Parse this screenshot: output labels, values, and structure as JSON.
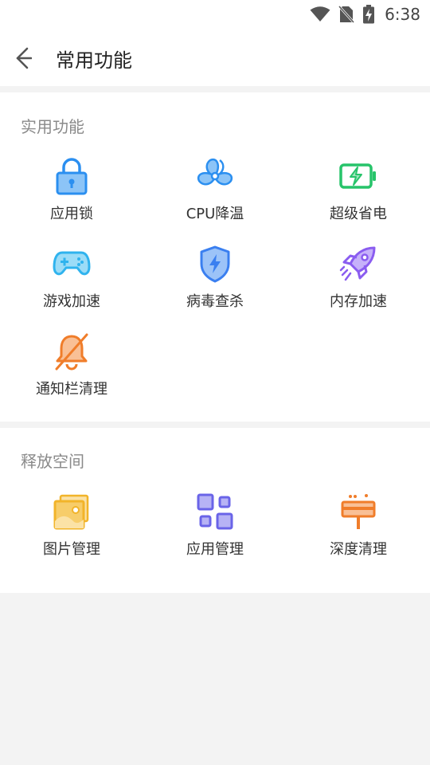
{
  "status_bar": {
    "time": "6:38",
    "icons": [
      "wifi-icon",
      "no-sim-icon",
      "battery-charging-icon"
    ]
  },
  "header": {
    "title": "常用功能",
    "back_icon": "back-arrow-icon"
  },
  "sections": [
    {
      "title": "实用功能",
      "items": [
        {
          "label": "应用锁",
          "icon": "lock-icon",
          "color": "#2b8ff0"
        },
        {
          "label": "CPU降温",
          "icon": "fan-icon",
          "color": "#2b8ff0"
        },
        {
          "label": "超级省电",
          "icon": "battery-bolt-icon",
          "color": "#27c46a"
        },
        {
          "label": "游戏加速",
          "icon": "gamepad-icon",
          "color": "#2fb3ee"
        },
        {
          "label": "病毒查杀",
          "icon": "shield-icon",
          "color": "#3a7ff0"
        },
        {
          "label": "内存加速",
          "icon": "rocket-icon",
          "color": "#8a5cf0"
        },
        {
          "label": "通知栏清理",
          "icon": "bell-off-icon",
          "color": "#f07d2a"
        }
      ]
    },
    {
      "title": "释放空间",
      "items": [
        {
          "label": "图片管理",
          "icon": "image-icon",
          "color": "#f2b42a"
        },
        {
          "label": "应用管理",
          "icon": "apps-grid-icon",
          "color": "#6a64e8"
        },
        {
          "label": "深度清理",
          "icon": "broom-icon",
          "color": "#f07d2a"
        }
      ]
    }
  ]
}
